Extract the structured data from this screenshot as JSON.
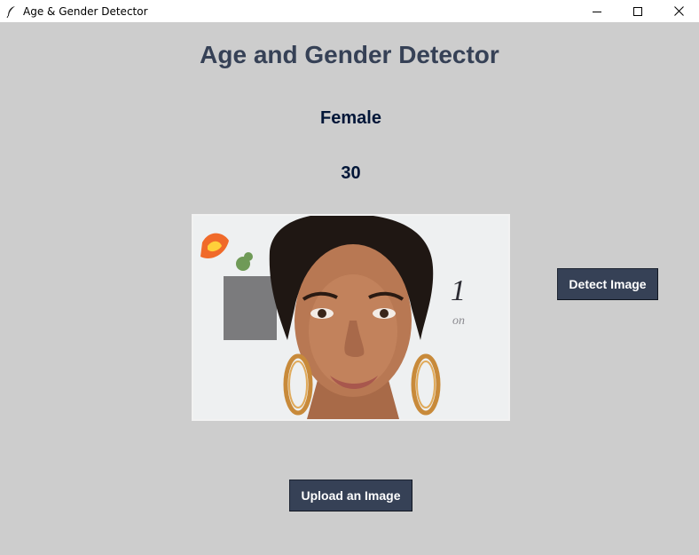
{
  "window": {
    "title": "Age & Gender Detector",
    "controls": [
      "minimize-icon",
      "maximize-icon",
      "close-icon"
    ]
  },
  "app": {
    "heading": "Age and Gender Detector",
    "gender_result": "Female",
    "age_result": "30",
    "detect_button": "Detect Image",
    "upload_button": "Upload an Image"
  },
  "colors": {
    "background": "#cdcdcd",
    "heading": "#364156",
    "result_text": "#011638",
    "button_bg": "#364156",
    "button_text": "#ffffff"
  }
}
